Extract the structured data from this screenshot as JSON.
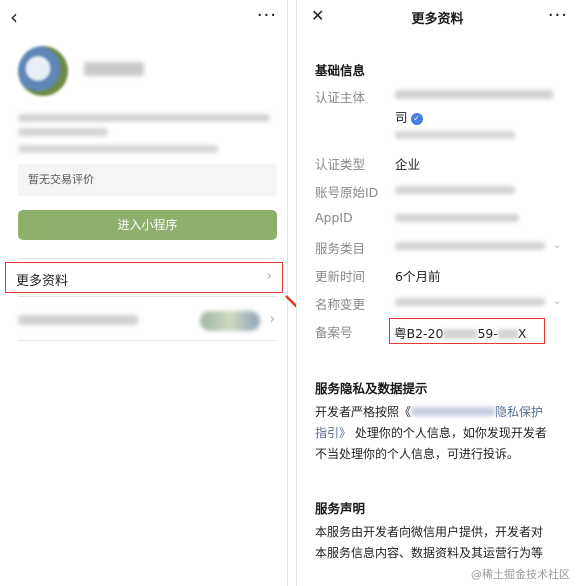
{
  "left": {
    "evaluation_text": "暂无交易评价",
    "enter_button_label": "进入小程序",
    "more_info_label": "更多资料",
    "chevron_glyph": "›",
    "back_glyph": "‹",
    "more_glyph": "···"
  },
  "right": {
    "title": "更多资料",
    "close_glyph": "✕",
    "more_glyph": "···",
    "basic_section": "基础信息",
    "subject_label": "认证主体",
    "subject_value_suffix": "司",
    "type_label": "认证类型",
    "type_value": "企业",
    "original_id_label": "账号原始ID",
    "appid_label": "AppID",
    "category_label": "服务类目",
    "update_label": "更新时间",
    "update_value": "6个月前",
    "name_change_label": "名称变更",
    "record_label": "备案号",
    "record_prefix": "粤B2-20",
    "record_middle": "59-",
    "record_suffix": "X",
    "privacy_section": "服务隐私及数据提示",
    "privacy_text_1": "开发者严格按照《",
    "privacy_link_tail": "隐私保护",
    "privacy_link_2": "指引》",
    "privacy_text_2": "处理你的个人信息，如你发现开发者",
    "privacy_text_3": "不当处理你的个人信息，可进行投诉。",
    "statement_section": "服务声明",
    "statement_text_1": "本服务由开发者向微信用户提供，开发者对",
    "statement_text_2": "本服务信息内容、数据资料及其运营行为等",
    "chevron_down_glyph": "⌄"
  },
  "watermark": "@稀土掘金技术社区",
  "colors": {
    "highlight": "#e53935",
    "button": "#8fb06c",
    "verified": "#4a7de0",
    "link": "#576b95"
  }
}
